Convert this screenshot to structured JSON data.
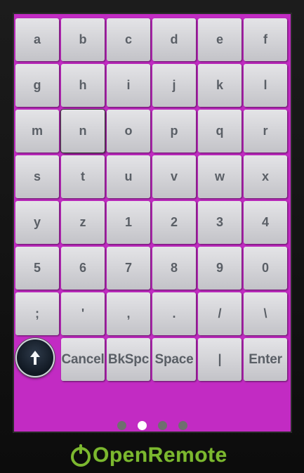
{
  "keyboard": {
    "rows": [
      [
        "a",
        "b",
        "c",
        "d",
        "e",
        "f"
      ],
      [
        "g",
        "h",
        "i",
        "j",
        "k",
        "l"
      ],
      [
        "m",
        "n",
        "o",
        "p",
        "q",
        "r"
      ],
      [
        "s",
        "t",
        "u",
        "v",
        "w",
        "x"
      ],
      [
        "y",
        "z",
        "1",
        "2",
        "3",
        "4"
      ],
      [
        "5",
        "6",
        "7",
        "8",
        "9",
        "0"
      ],
      [
        ";",
        "'",
        ",",
        ".",
        "/",
        "\\"
      ]
    ],
    "bottom": {
      "shift_icon": "up-arrow-icon",
      "cancel": "Cancel",
      "backspace": "BkSpc",
      "space": "Space",
      "pipe": "|",
      "enter": "Enter"
    }
  },
  "pager": {
    "pages": 4,
    "active_index": 1
  },
  "brand": {
    "logo_text": "OpenRemote",
    "color": "#7cb82f"
  },
  "colors": {
    "background": "#c22bc3",
    "key": "#d6d6da",
    "key_text": "#5a5f66"
  }
}
